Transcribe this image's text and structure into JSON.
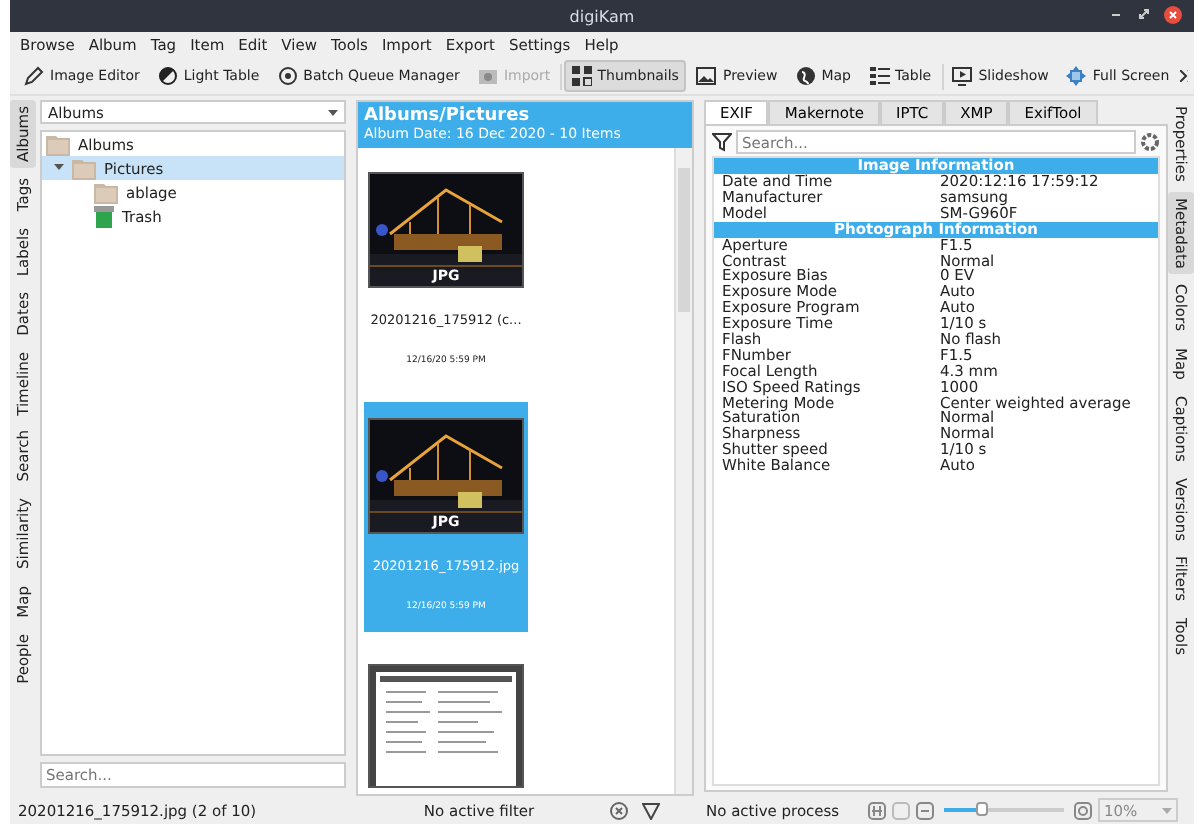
{
  "window": {
    "title": "digiKam"
  },
  "menu": [
    "Browse",
    "Album",
    "Tag",
    "Item",
    "Edit",
    "View",
    "Tools",
    "Import",
    "Export",
    "Settings",
    "Help"
  ],
  "toolbar": [
    {
      "label": "Image Editor",
      "selected": false,
      "disabled": false
    },
    {
      "label": "Light Table",
      "selected": false,
      "disabled": false
    },
    {
      "label": "Batch Queue Manager",
      "selected": false,
      "disabled": false
    },
    {
      "label": "Import",
      "selected": false,
      "disabled": true
    },
    {
      "label": "Thumbnails",
      "selected": true,
      "disabled": false
    },
    {
      "label": "Preview",
      "selected": false,
      "disabled": false
    },
    {
      "label": "Map",
      "selected": false,
      "disabled": false
    },
    {
      "label": "Table",
      "selected": false,
      "disabled": false
    },
    {
      "label": "Slideshow",
      "selected": false,
      "disabled": false
    },
    {
      "label": "Full Screen",
      "selected": false,
      "disabled": false
    }
  ],
  "left_tabs": [
    {
      "label": "Albums",
      "selected": true
    },
    {
      "label": "Tags",
      "selected": false
    },
    {
      "label": "Labels",
      "selected": false
    },
    {
      "label": "Dates",
      "selected": false
    },
    {
      "label": "Timeline",
      "selected": false
    },
    {
      "label": "Search",
      "selected": false
    },
    {
      "label": "Similarity",
      "selected": false
    },
    {
      "label": "Map",
      "selected": false
    },
    {
      "label": "People",
      "selected": false
    }
  ],
  "albums_panel": {
    "selector": "Albums",
    "tree": [
      {
        "label": "Albums",
        "kind": "folder",
        "selected": false,
        "children": [
          {
            "label": "Pictures",
            "kind": "folder",
            "selected": true,
            "expanded": true,
            "children": [
              {
                "label": "ablage",
                "kind": "folder",
                "selected": false
              },
              {
                "label": "Trash",
                "kind": "trash",
                "selected": false
              }
            ]
          }
        ]
      }
    ],
    "search": {
      "placeholder": "Search..."
    }
  },
  "thumbnails": {
    "title": "Albums/Pictures",
    "subtitle": "Album Date: 16 Dec 2020 - 10 Items",
    "items": [
      {
        "badge": "JPG",
        "name": "20201216_175912 (c...",
        "date": "12/16/20 5:59 PM",
        "selected": false
      },
      {
        "badge": "JPG",
        "name": "20201216_175912.jpg",
        "date": "12/16/20 5:59 PM",
        "selected": true
      },
      {
        "kind": "document",
        "selected": false
      }
    ]
  },
  "metadata": {
    "tabs": [
      {
        "label": "EXIF",
        "selected": true
      },
      {
        "label": "Makernote",
        "selected": false
      },
      {
        "label": "IPTC",
        "selected": false
      },
      {
        "label": "XMP",
        "selected": false
      },
      {
        "label": "ExifTool",
        "selected": false
      }
    ],
    "search": {
      "placeholder": "Search..."
    },
    "sections": [
      {
        "title": "Image Information",
        "rows": [
          {
            "name": "Date and Time",
            "value": "2020:12:16 17:59:12"
          },
          {
            "name": "Manufacturer",
            "value": "samsung"
          },
          {
            "name": "Model",
            "value": "SM-G960F"
          }
        ]
      },
      {
        "title": "Photograph Information",
        "rows": [
          {
            "name": "Aperture",
            "value": "F1.5"
          },
          {
            "name": "Contrast",
            "value": "Normal"
          },
          {
            "name": "Exposure Bias",
            "value": "0 EV"
          },
          {
            "name": "Exposure Mode",
            "value": "Auto"
          },
          {
            "name": "Exposure Program",
            "value": "Auto"
          },
          {
            "name": "Exposure Time",
            "value": "1/10 s"
          },
          {
            "name": "Flash",
            "value": "No flash"
          },
          {
            "name": "FNumber",
            "value": "F1.5"
          },
          {
            "name": "Focal Length",
            "value": "4.3 mm"
          },
          {
            "name": "ISO Speed Ratings",
            "value": "1000"
          },
          {
            "name": "Metering Mode",
            "value": "Center weighted average"
          },
          {
            "name": "Saturation",
            "value": "Normal"
          },
          {
            "name": "Sharpness",
            "value": "Normal"
          },
          {
            "name": "Shutter speed",
            "value": "1/10 s"
          },
          {
            "name": "White Balance",
            "value": "Auto"
          }
        ]
      }
    ]
  },
  "right_tabs": [
    {
      "label": "Properties",
      "selected": false
    },
    {
      "label": "Metadata",
      "selected": true
    },
    {
      "label": "Colors",
      "selected": false
    },
    {
      "label": "Map",
      "selected": false
    },
    {
      "label": "Captions",
      "selected": false
    },
    {
      "label": "Versions",
      "selected": false
    },
    {
      "label": "Filters",
      "selected": false
    },
    {
      "label": "Tools",
      "selected": false
    }
  ],
  "status_bar": {
    "file": "20201216_175912.jpg (2 of 10)",
    "filter": "No active filter",
    "process": "No active process",
    "zoom": {
      "level": 0.32,
      "value": "10%"
    }
  }
}
